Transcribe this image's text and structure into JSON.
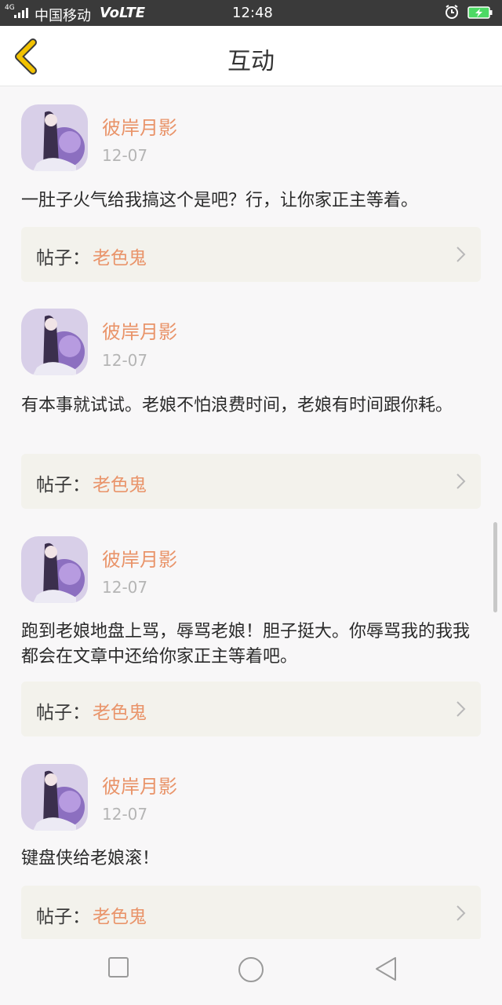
{
  "status_bar": {
    "network": "4G",
    "carrier": "中国移动",
    "volte": "VoLTE",
    "time": "12:48",
    "icons": [
      "signal-icon",
      "alarm-icon",
      "battery-charging-icon"
    ]
  },
  "header": {
    "title": "互动",
    "back_icon": "back-chevron-icon",
    "accent": "#f2c200"
  },
  "items": [
    {
      "user": "彼岸月影",
      "date": "12-07",
      "text": "一肚子火气给我搞这个是吧？行，让你家正主等着。",
      "post_label": "帖子：",
      "post_title": "老色鬼"
    },
    {
      "user": "彼岸月影",
      "date": "12-07",
      "text": "有本事就试试。老娘不怕浪费时间，老娘有时间跟你耗。",
      "post_label": "帖子：",
      "post_title": "老色鬼"
    },
    {
      "user": "彼岸月影",
      "date": "12-07",
      "text": "跑到老娘地盘上骂，辱骂老娘！胆子挺大。你辱骂我的我我都会在文章中还给你家正主等着吧。",
      "post_label": "帖子：",
      "post_title": "老色鬼"
    },
    {
      "user": "彼岸月影",
      "date": "12-07",
      "text": "键盘侠给老娘滚！",
      "post_label": "帖子：",
      "post_title": "老色鬼"
    }
  ],
  "colors": {
    "name": "#e9946a",
    "post_bg": "#f3f2ec",
    "page_bg": "#f8f7f8"
  },
  "nav_icons": [
    "recent-apps-icon",
    "home-icon",
    "back-icon"
  ]
}
